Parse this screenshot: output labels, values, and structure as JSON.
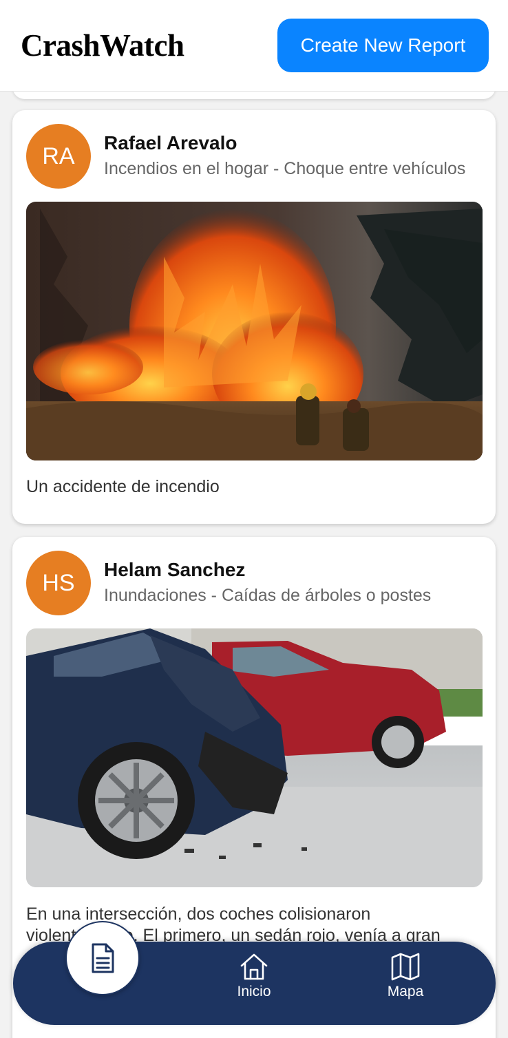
{
  "header": {
    "logo": "CrashWatch",
    "create_button": "Create New Report"
  },
  "posts": [
    {
      "initials": "RA",
      "name": "Rafael Arevalo",
      "categories": "Incendios en el hogar - Choque entre vehículos",
      "description": "Un accidente de incendio",
      "image": "wildfire-photo",
      "avatar_color": "#e67e22"
    },
    {
      "initials": "HS",
      "name": "Helam Sanchez",
      "categories": "Inundaciones - Caídas de árboles o postes",
      "description": "En una intersección, dos coches colisionaron violentamente. El primero, un sedán rojo, venía a gran velocidad y no alcanzó a ver el vehículo rojo que se aproximaba rápidamente.",
      "image": "car-crash-photo",
      "avatar_color": "#e67e22"
    }
  ],
  "bottom_nav": {
    "items": [
      {
        "label": "",
        "icon": "document-icon"
      },
      {
        "label": "Inicio",
        "icon": "home-icon"
      },
      {
        "label": "Mapa",
        "icon": "map-icon"
      }
    ]
  },
  "colors": {
    "accent": "#0a84ff",
    "nav_background": "#1d3461",
    "avatar": "#e67e22"
  }
}
